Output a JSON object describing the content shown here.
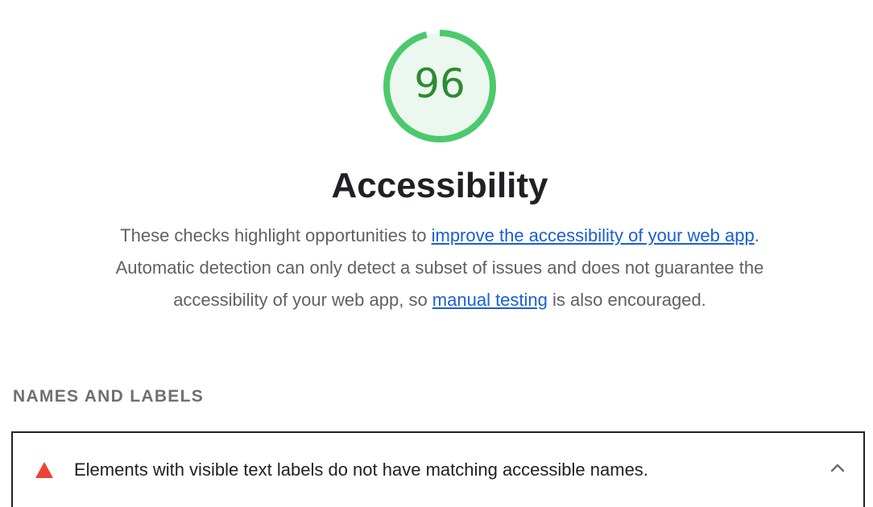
{
  "gauge": {
    "score": "96",
    "fraction": 0.96,
    "color": "#4cc96d",
    "fill_color": "#ecf8ef",
    "text_color": "#2e8a32"
  },
  "category": {
    "title": "Accessibility",
    "description": {
      "part1": "These checks highlight opportunities to ",
      "link1": "improve the accessibility of your web app",
      "part2": ". Automatic detection can only detect a subset of issues and does not guarantee the accessibility of your web app, so ",
      "link2": "manual testing",
      "part3": " is also encouraged."
    }
  },
  "section": {
    "title": "NAMES AND LABELS"
  },
  "audit": {
    "icon": "fail-triangle-icon",
    "icon_color": "#eb4335",
    "title": "Elements with visible text labels do not have matching accessible names.",
    "toggle_icon": "chevron-up-icon"
  }
}
